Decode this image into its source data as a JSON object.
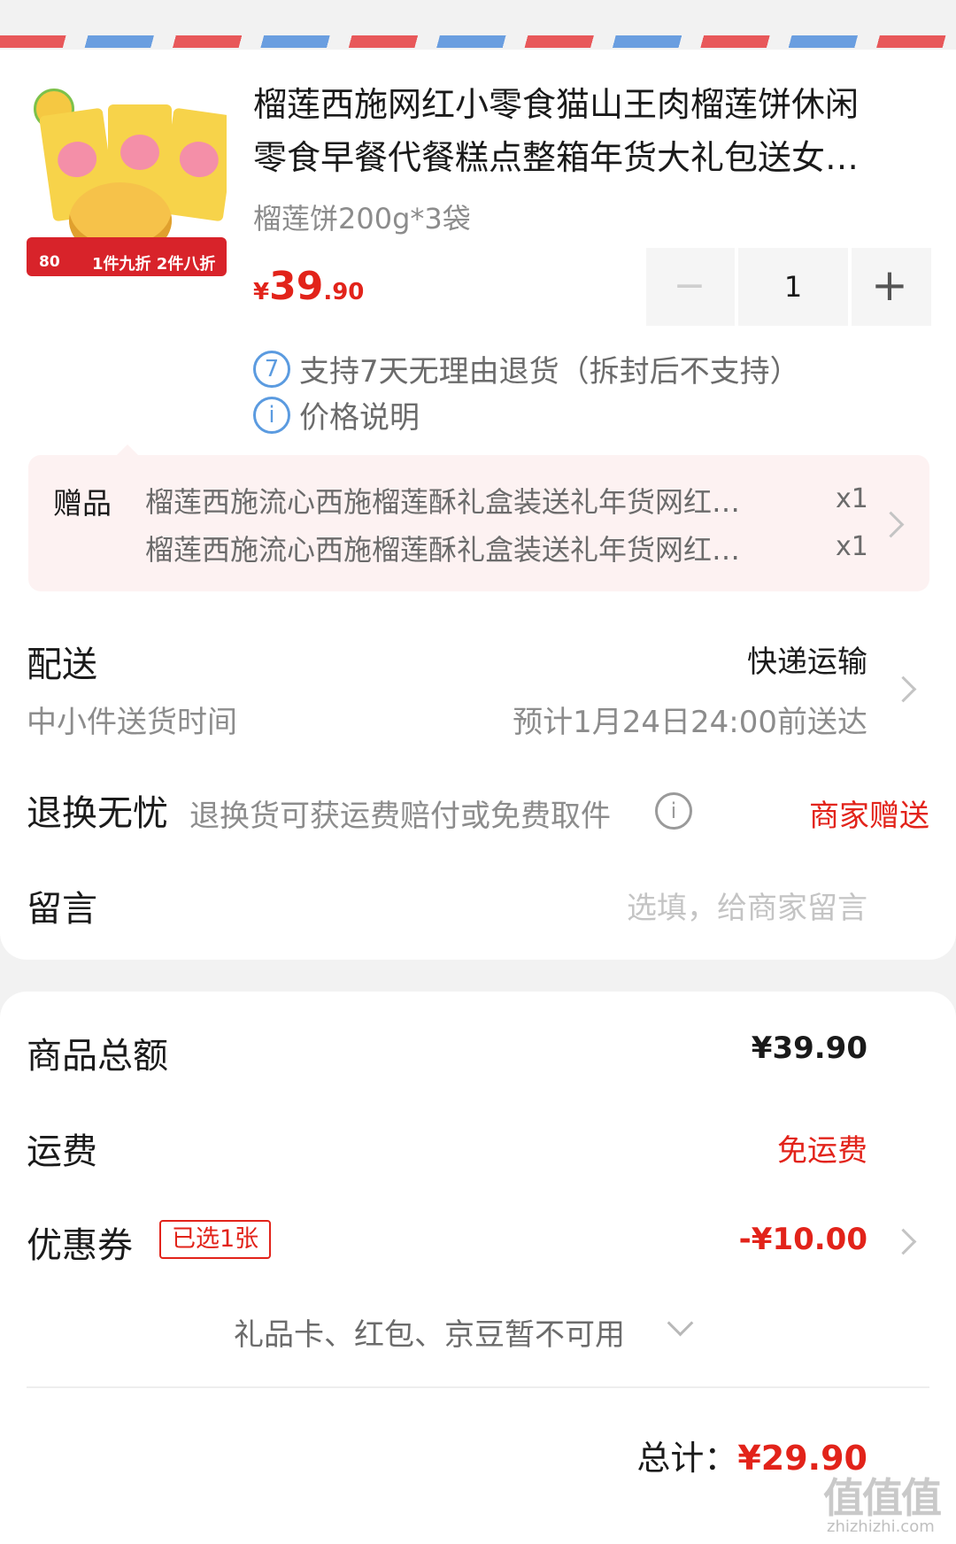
{
  "product": {
    "title_line1": "榴莲西施网红小零食猫山王肉榴莲饼休闲",
    "title_line2": "零食早餐代餐糕点整箱年货大礼包送女…",
    "spec": "榴莲饼200g*3袋",
    "price_currency": "¥",
    "price_int": "39",
    "price_dec": ".90",
    "image_band_num": "80",
    "image_band_text": "1件九折 2件八折",
    "quantity": "1",
    "minus_symbol": "−",
    "plus_symbol": "+"
  },
  "services": {
    "return_icon_text": "7",
    "return_text": "支持7天无理由退货（拆封后不支持）",
    "price_icon_text": "i",
    "price_text": "价格说明"
  },
  "gifts": {
    "label": "赠品",
    "items": [
      {
        "name": "榴莲西施流心西施榴莲酥礼盒装送礼年货网红…",
        "qty": "x1"
      },
      {
        "name": "榴莲西施流心西施榴莲酥礼盒装送礼年货网红…",
        "qty": "x1"
      }
    ]
  },
  "delivery": {
    "label": "配送",
    "method": "快递运输",
    "time_label": "中小件送货时间",
    "time_value": "预计1月24日24:00前送达"
  },
  "return_service": {
    "label": "退换无忧",
    "desc": "退换货可获运费赔付或免费取件",
    "info_icon_text": "i",
    "value": "商家赠送"
  },
  "message": {
    "label": "留言",
    "placeholder": "选填，给商家留言"
  },
  "summary": {
    "subtotal_label": "商品总额",
    "subtotal_value": "¥39.90",
    "shipping_label": "运费",
    "shipping_value": "免运费",
    "coupon_label": "优惠券",
    "coupon_badge": "已选1张",
    "coupon_value": "-¥10.00",
    "unavailable_text": "礼品卡、红包、京豆暂不可用",
    "total_label": "总计：",
    "total_value": "¥29.90"
  },
  "watermark": {
    "main": "值值值",
    "sub": "zhizhizhi.com"
  },
  "colors": {
    "accent_red": "#e2231a",
    "info_blue": "#5b9be0",
    "stripe_red": "#e8585a",
    "stripe_blue": "#6a9ee0",
    "gift_bg": "#fdf2f2"
  }
}
